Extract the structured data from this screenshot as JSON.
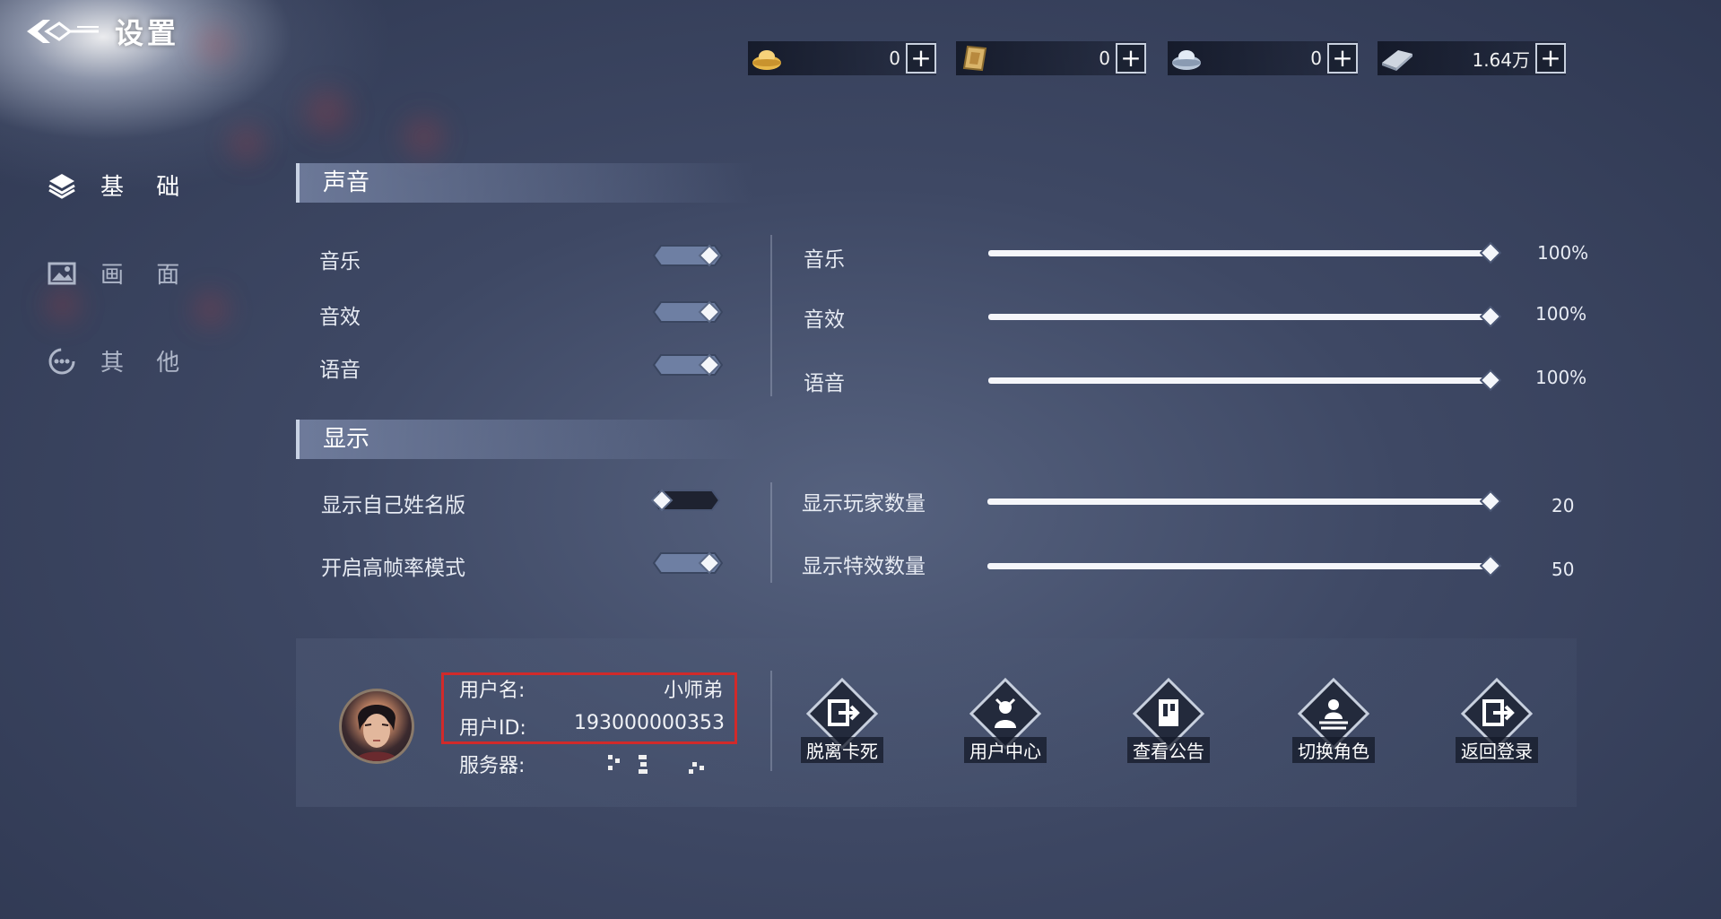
{
  "header": {
    "title": "设置",
    "back_icon": "back-arrow-icon"
  },
  "currencies": [
    {
      "icon": "gold-ingot-icon",
      "value": "0"
    },
    {
      "icon": "scroll-token-icon",
      "value": "0"
    },
    {
      "icon": "silver-ingot-icon",
      "value": "0"
    },
    {
      "icon": "silver-bar-icon",
      "value": "1.64万"
    }
  ],
  "sidebar": {
    "items": [
      {
        "label": "基 础",
        "icon": "layers-icon",
        "active": true
      },
      {
        "label": "画 面",
        "icon": "picture-icon",
        "active": false
      },
      {
        "label": "其 他",
        "icon": "more-icon",
        "active": false
      }
    ]
  },
  "sound": {
    "header": "声音",
    "toggles": [
      {
        "label": "音乐",
        "on": true
      },
      {
        "label": "音效",
        "on": true
      },
      {
        "label": "语音",
        "on": true
      }
    ],
    "sliders": [
      {
        "label": "音乐",
        "value": 100,
        "display": "100%"
      },
      {
        "label": "音效",
        "value": 100,
        "display": "100%"
      },
      {
        "label": "语音",
        "value": 100,
        "display": "100%"
      }
    ]
  },
  "display": {
    "header": "显示",
    "toggles": [
      {
        "label": "显示自己姓名版",
        "on": false
      },
      {
        "label": "开启高帧率模式",
        "on": true
      }
    ],
    "sliders": [
      {
        "label": "显示玩家数量",
        "value": 20,
        "display": "20",
        "fill": 1.0
      },
      {
        "label": "显示特效数量",
        "value": 50,
        "display": "50",
        "fill": 1.0
      }
    ]
  },
  "user": {
    "name_label": "用户名:",
    "name_value": "小师弟",
    "id_label": "用户ID:",
    "id_value": "193000000353",
    "server_label": "服务器:"
  },
  "actions": [
    {
      "label": "脱离卡死",
      "icon": "exit-stuck-icon"
    },
    {
      "label": "用户中心",
      "icon": "user-center-icon"
    },
    {
      "label": "查看公告",
      "icon": "announcement-icon"
    },
    {
      "label": "切换角色",
      "icon": "switch-character-icon"
    },
    {
      "label": "返回登录",
      "icon": "return-login-icon"
    }
  ],
  "colors": {
    "highlight_box": "#d12a2a",
    "slider_track": "#f5f6fa",
    "toggle_on": "#6e7fa3",
    "toggle_off": "#1e2230"
  }
}
